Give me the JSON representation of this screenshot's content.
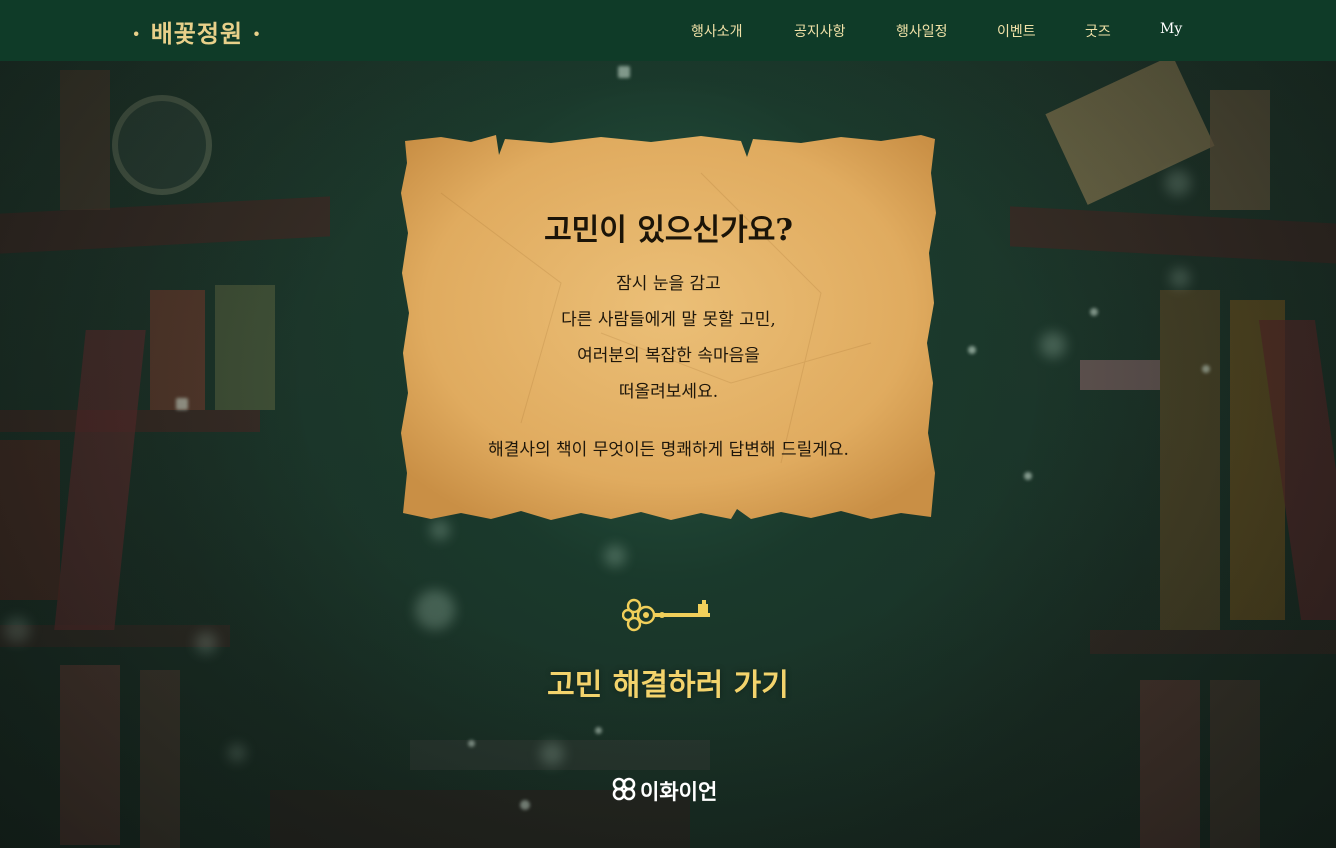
{
  "header": {
    "logo": "· 배꽃정원 ·",
    "nav": [
      {
        "label": "행사소개"
      },
      {
        "label": "공지사항"
      },
      {
        "label": "행사일정"
      },
      {
        "label": "이벤트"
      },
      {
        "label": "굿즈"
      },
      {
        "label": "My"
      }
    ]
  },
  "parchment": {
    "title": "고민이 있으신가요?",
    "lines": [
      "잠시 눈을 감고",
      "다른 사람들에게 말 못할 고민,",
      "여러분의 복잡한 속마음을",
      "떠올려보세요."
    ],
    "closing": "해결사의 책이 무엇이든 명쾌하게 답변해 드릴게요."
  },
  "cta": {
    "icon": "key-icon",
    "label": "고민 해결하러 가기"
  },
  "footer": {
    "brand_icon": "pear-blossom-icon",
    "brand": "이화이언"
  },
  "colors": {
    "header_bg": "#0f3b28",
    "accent_gold": "#f3d36c",
    "parchment": "#e3b369"
  }
}
